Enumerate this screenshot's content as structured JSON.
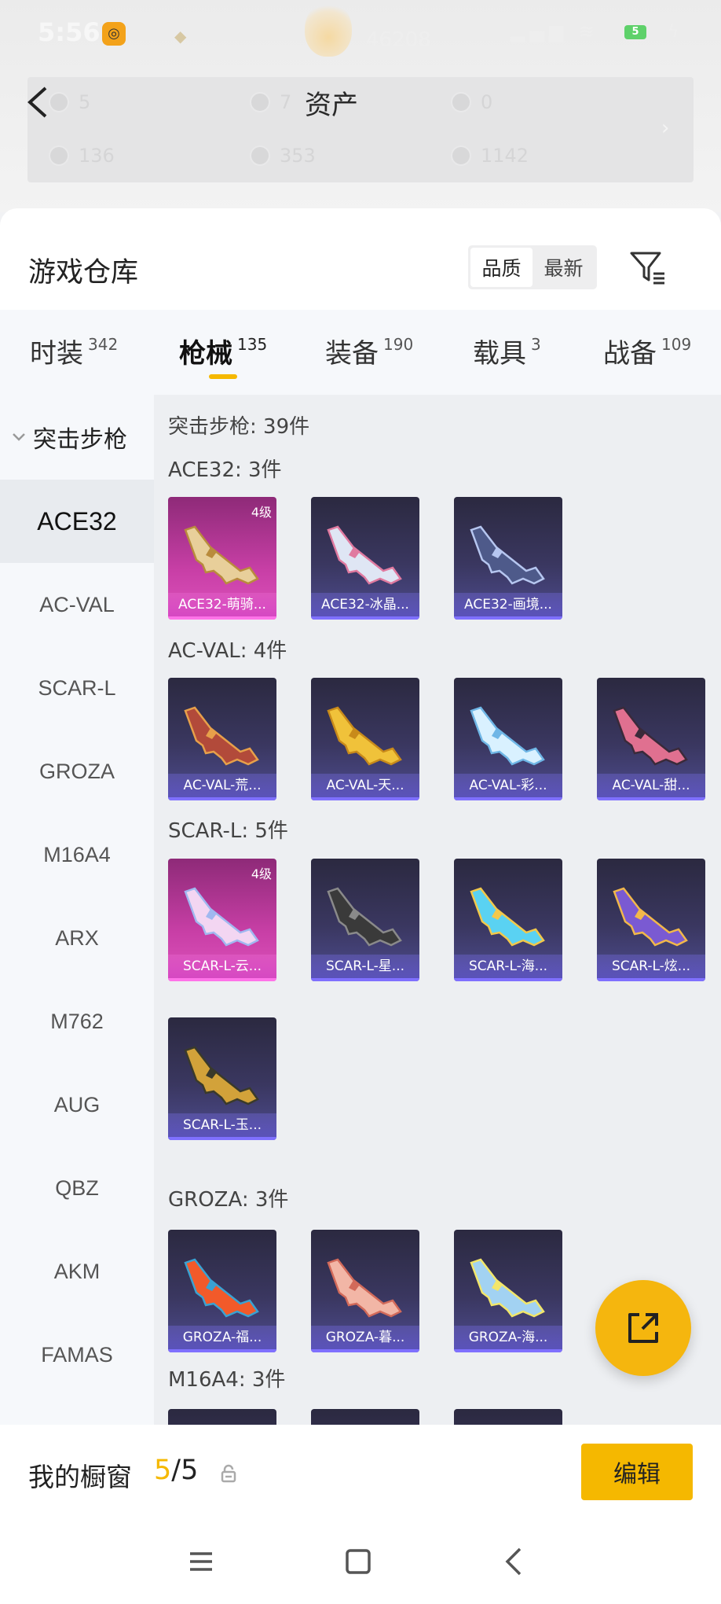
{
  "status_bar": {
    "time": "5:56",
    "score": "46208",
    "battery": "5"
  },
  "assets": {
    "title": "资产",
    "items": [
      {
        "value": "5"
      },
      {
        "value": "7"
      },
      {
        "value": "0"
      },
      {
        "value": "136"
      },
      {
        "value": "353"
      },
      {
        "value": "1142"
      }
    ]
  },
  "warehouse": {
    "title": "游戏仓库",
    "sort": [
      "品质",
      "最新"
    ],
    "sort_active": "品质"
  },
  "categories": [
    {
      "label": "时装",
      "count": "342"
    },
    {
      "label": "枪械",
      "count": "135",
      "active": true
    },
    {
      "label": "装备",
      "count": "190"
    },
    {
      "label": "载具",
      "count": "3"
    },
    {
      "label": "战备",
      "count": "109"
    }
  ],
  "sidebar": {
    "group": "突击步枪",
    "items": [
      "ACE32",
      "AC-VAL",
      "SCAR-L",
      "GROZA",
      "M16A4",
      "ARX",
      "M762",
      "AUG",
      "QBZ",
      "AKM",
      "FAMAS"
    ],
    "active": "ACE32"
  },
  "content": {
    "total": "突击步枪: 39件",
    "sections": [
      {
        "head": "ACE32: 3件",
        "cards": [
          {
            "name": "ACE32-萌骑...",
            "level": "4级",
            "rarity": "pink"
          },
          {
            "name": "ACE32-冰晶...",
            "rarity": "purple"
          },
          {
            "name": "ACE32-画境...",
            "rarity": "purple"
          }
        ]
      },
      {
        "head": "AC-VAL: 4件",
        "cards": [
          {
            "name": "AC-VAL-荒...",
            "rarity": "purple"
          },
          {
            "name": "AC-VAL-天...",
            "rarity": "purple"
          },
          {
            "name": "AC-VAL-彩...",
            "rarity": "purple"
          },
          {
            "name": "AC-VAL-甜...",
            "rarity": "purple"
          }
        ]
      },
      {
        "head": "SCAR-L: 5件",
        "cards": [
          {
            "name": "SCAR-L-云...",
            "level": "4级",
            "rarity": "pink"
          },
          {
            "name": "SCAR-L-星...",
            "rarity": "purple"
          },
          {
            "name": "SCAR-L-海...",
            "rarity": "purple"
          },
          {
            "name": "SCAR-L-炫...",
            "rarity": "purple"
          },
          {
            "name": "SCAR-L-玉...",
            "rarity": "purple"
          }
        ]
      },
      {
        "head": "GROZA: 3件",
        "cards": [
          {
            "name": "GROZA-福...",
            "rarity": "purple"
          },
          {
            "name": "GROZA-暮...",
            "rarity": "purple"
          },
          {
            "name": "GROZA-海...",
            "rarity": "purple"
          }
        ]
      },
      {
        "head": "M16A4: 3件",
        "cards": [
          {
            "name": "",
            "rarity": "purple"
          },
          {
            "name": "",
            "rarity": "purple"
          },
          {
            "name": "",
            "rarity": "purple"
          }
        ]
      }
    ]
  },
  "showcase": {
    "label": "我的橱窗",
    "current": "5",
    "total": "5",
    "edit_label": "编辑"
  },
  "colors": {
    "accent": "#f5b800",
    "pink_card": "#c83fa6",
    "purple_card": "#3a3760"
  },
  "icons": [
    "back-arrow-icon",
    "filter-icon",
    "chevron-down-icon",
    "share-icon",
    "lock-icon",
    "menu-icon",
    "home-icon",
    "back-icon"
  ]
}
